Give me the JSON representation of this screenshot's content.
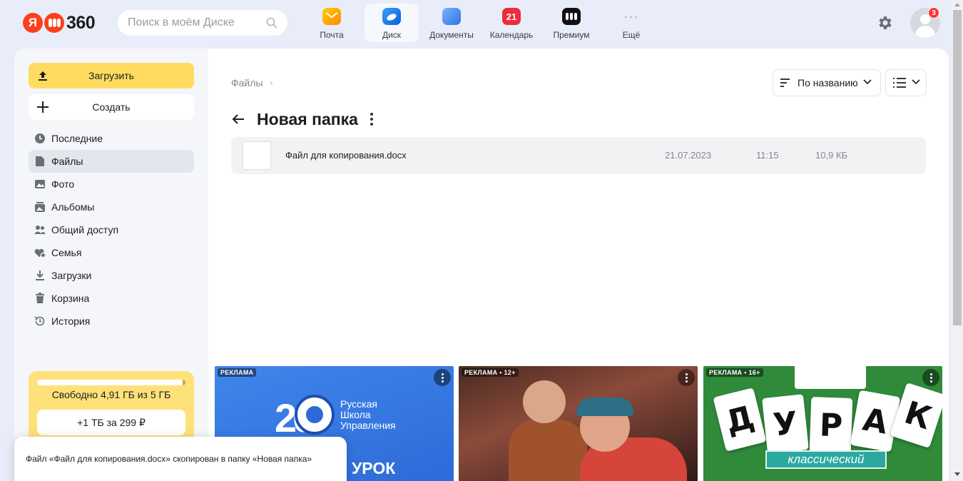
{
  "header": {
    "logo_letter": "Я",
    "logo_text": "360",
    "search_placeholder": "Поиск в моём Диске",
    "apps": [
      {
        "label": "Почта",
        "icon": "mail-icon"
      },
      {
        "label": "Диск",
        "icon": "disk-icon",
        "active": true
      },
      {
        "label": "Документы",
        "icon": "documents-icon"
      },
      {
        "label": "Календарь",
        "icon": "calendar-icon",
        "day": "21"
      },
      {
        "label": "Премиум",
        "icon": "premium-icon"
      },
      {
        "label": "Ещё",
        "icon": "more-icon",
        "glyph": "···"
      }
    ],
    "notifications_count": "3"
  },
  "sidebar": {
    "upload_label": "Загрузить",
    "create_label": "Создать",
    "items": [
      {
        "label": "Последние",
        "icon": "clock-icon"
      },
      {
        "label": "Файлы",
        "icon": "file-icon",
        "active": true
      },
      {
        "label": "Фото",
        "icon": "photo-icon"
      },
      {
        "label": "Альбомы",
        "icon": "album-icon"
      },
      {
        "label": "Общий доступ",
        "icon": "shared-icon"
      },
      {
        "label": "Семья",
        "icon": "family-icon"
      },
      {
        "label": "Загрузки",
        "icon": "download-icon"
      },
      {
        "label": "Корзина",
        "icon": "trash-icon"
      },
      {
        "label": "История",
        "icon": "history-icon"
      }
    ],
    "storage": {
      "used_fraction": 0.018,
      "free_text": "Свободно 4,91 ГБ из 5 ГБ",
      "buy_label": "+1 ТБ за 299 ₽"
    }
  },
  "content": {
    "breadcrumb": "Файлы",
    "breadcrumb_sep": "›",
    "sort_label": "По названию",
    "folder_title": "Новая папка",
    "files": [
      {
        "name": "Файл для копирования.docx",
        "date": "21.07.2023",
        "time": "11:15",
        "size": "10,9 КБ"
      }
    ]
  },
  "ads": [
    {
      "tag": "РЕКЛАМА",
      "lines": [
        "Русская",
        "Школа",
        "Управления"
      ],
      "number": "20",
      "headline": "УРОК"
    },
    {
      "tag": "РЕКЛАМА • 12+"
    },
    {
      "tag": "РЕКЛАМА • 16+",
      "letters": [
        "Д",
        "У",
        "Р",
        "А",
        "К"
      ],
      "subtitle": "классический"
    }
  ],
  "toast": {
    "text": "Файл «Файл для копирования.docx» скопирован в папку «Новая папка»"
  },
  "colors": {
    "page_bg": "#e9edf9",
    "upload_button": "#ffdc60",
    "storage_card": "#ffe17a",
    "active_nav": "#e3e6ed",
    "notification_badge": "#ff3333"
  }
}
